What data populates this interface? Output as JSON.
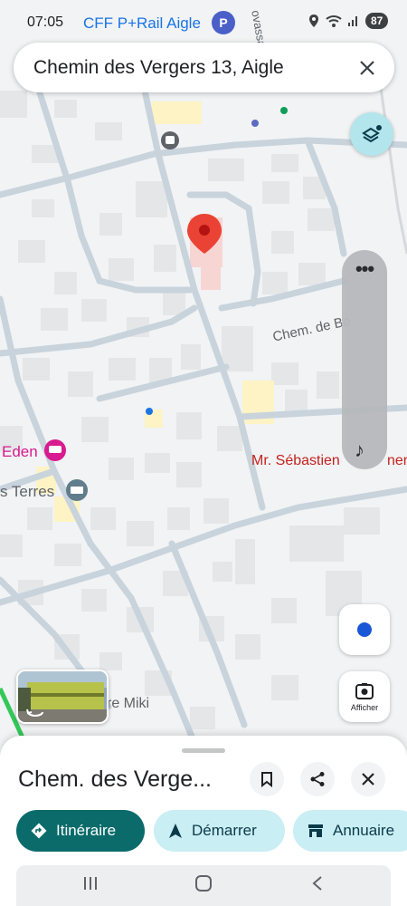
{
  "status_bar": {
    "time": "07:05",
    "battery": "87"
  },
  "map": {
    "top_label": "CFF P+Rail Aigle",
    "parking_badge": "P",
    "street_label_vertical": "ovassa",
    "street_label": "Chem. de Bo",
    "poi_eden": "Eden",
    "poi_terres": "s Terres",
    "poi_sebastien": "Mr. Sébastien",
    "poi_sebastien_tail": "ner",
    "poi_miki": "re Miki"
  },
  "search": {
    "query": "Chemin des Vergers 13, Aigle"
  },
  "controls": {
    "afficher_label": "Afficher"
  },
  "sheet": {
    "title": "Chem. des Verge...",
    "chips": {
      "itinerary": "Itinéraire",
      "start": "Démarrer",
      "directory": "Annuaire"
    }
  },
  "icons": {
    "search_close": "close-icon",
    "layers": "layers-icon",
    "more": "more-icon",
    "music": "music-note-icon",
    "location": "my-location-icon",
    "lens": "camera-lens-icon",
    "bookmark": "bookmark-icon",
    "share": "share-icon",
    "close": "close-icon",
    "directions": "directions-icon",
    "navigation": "navigation-arrow-icon",
    "store": "store-icon"
  },
  "colors": {
    "accent": "#0b6b6b",
    "chip_secondary": "#c9eef4",
    "pin": "#ea4335",
    "link_blue": "#1a73e8",
    "poi_red": "#c5221f",
    "poi_pink": "#d81b8f"
  }
}
